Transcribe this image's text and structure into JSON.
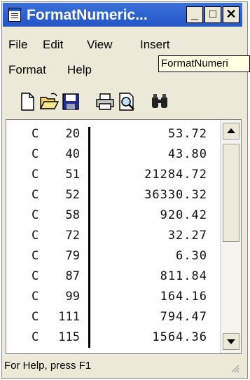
{
  "window": {
    "title": "FormatNumeric...",
    "controls": {
      "minimize": "_",
      "maximize": "□",
      "close": "✕"
    }
  },
  "menu": {
    "items": [
      "File",
      "Edit",
      "View",
      "Insert",
      "Format",
      "Help"
    ]
  },
  "tooltip": {
    "text": "FormatNumeri"
  },
  "toolbar": {
    "icons": [
      "new-file-icon",
      "open-folder-icon",
      "save-icon",
      "print-icon",
      "print-preview-icon",
      "find-icon"
    ]
  },
  "rows": [
    {
      "c": "C",
      "n": "20",
      "v": "53.72"
    },
    {
      "c": "C",
      "n": "40",
      "v": "43.80"
    },
    {
      "c": "C",
      "n": "51",
      "v": "21284.72"
    },
    {
      "c": "C",
      "n": "52",
      "v": "36330.32"
    },
    {
      "c": "C",
      "n": "58",
      "v": "920.42"
    },
    {
      "c": "C",
      "n": "72",
      "v": "32.27"
    },
    {
      "c": "C",
      "n": "79",
      "v": "6.30"
    },
    {
      "c": "C",
      "n": "87",
      "v": "811.84"
    },
    {
      "c": "C",
      "n": "99",
      "v": "164.16"
    },
    {
      "c": "C",
      "n": "111",
      "v": "794.47"
    },
    {
      "c": "C",
      "n": "115",
      "v": "1564.36"
    }
  ],
  "status": {
    "text": "For Help, press F1"
  }
}
